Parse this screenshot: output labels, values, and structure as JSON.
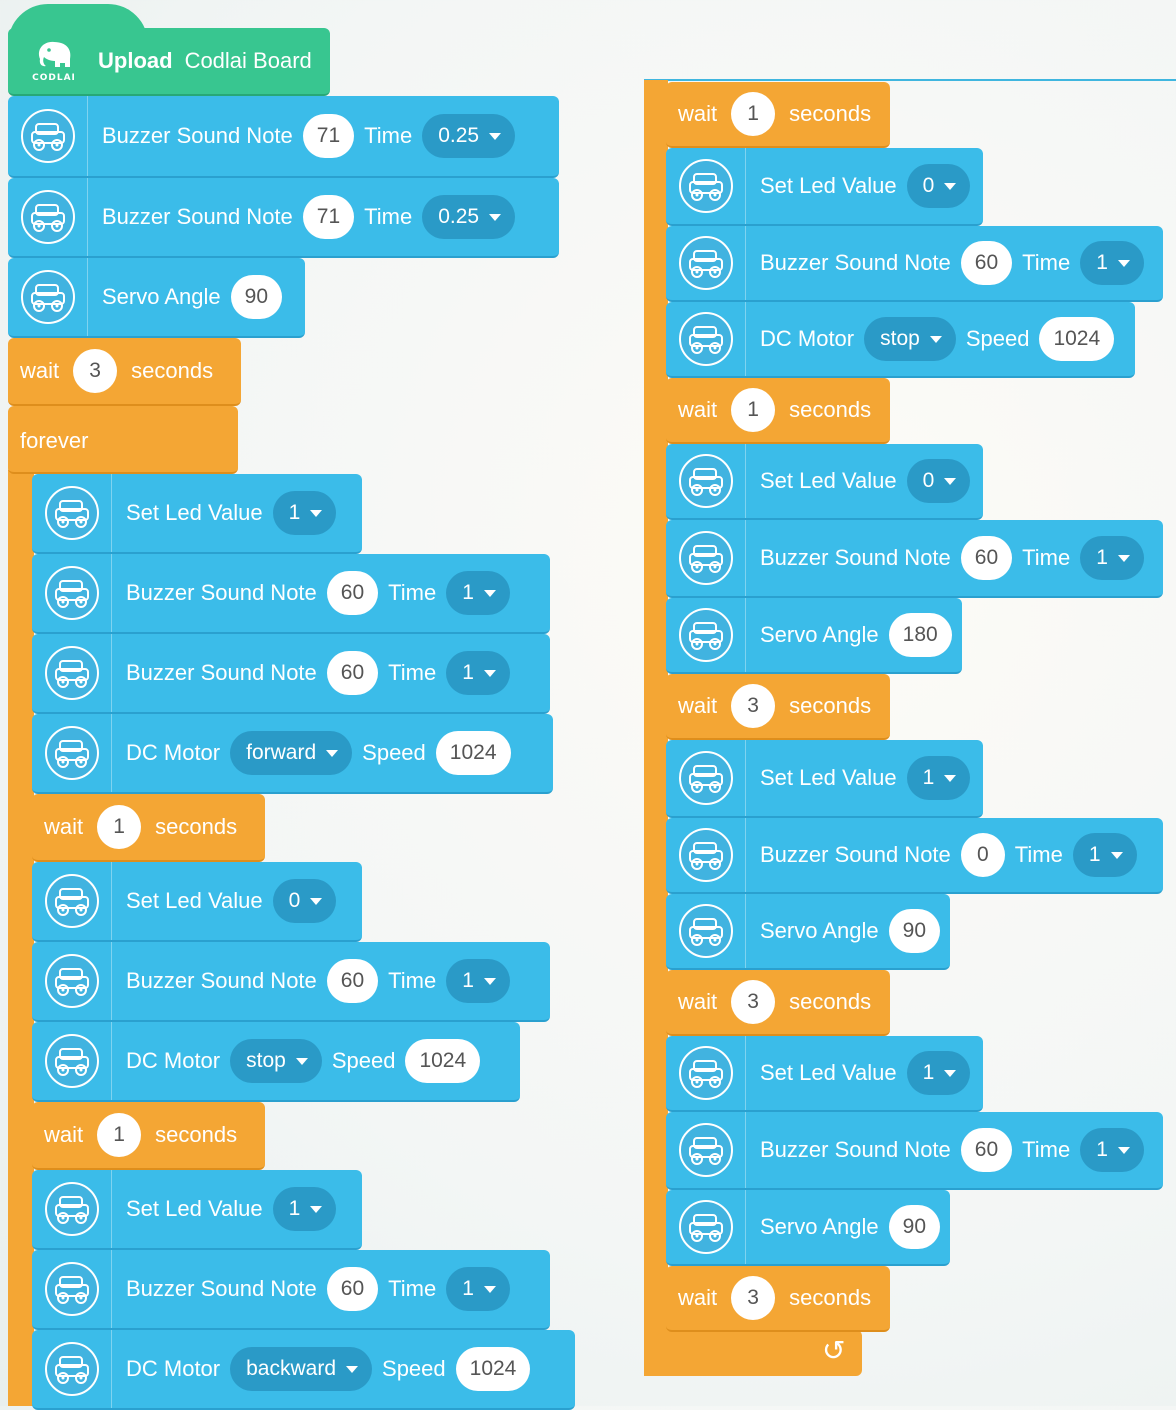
{
  "header": {
    "logo_text": "CODLAI",
    "upload_label": "Upload",
    "board_label": "Codlai Board"
  },
  "left_column": [
    {
      "kind": "device",
      "label": "Buzzer Sound Note",
      "value": "71",
      "label2": "Time",
      "dropdown": "0.25"
    },
    {
      "kind": "device",
      "label": "Buzzer Sound Note",
      "value": "71",
      "label2": "Time",
      "dropdown": "0.25"
    },
    {
      "kind": "device",
      "label": "Servo Angle",
      "value": "90"
    },
    {
      "kind": "wait",
      "label": "wait",
      "value": "3",
      "suffix": "seconds"
    },
    {
      "kind": "forever",
      "label": "forever"
    },
    {
      "kind": "device",
      "label": "Set Led Value",
      "dropdown": "1"
    },
    {
      "kind": "device",
      "label": "Buzzer Sound Note",
      "value": "60",
      "label2": "Time",
      "dropdown": "1"
    },
    {
      "kind": "device",
      "label": "Buzzer Sound Note",
      "value": "60",
      "label2": "Time",
      "dropdown": "1"
    },
    {
      "kind": "device",
      "label": "DC Motor",
      "dropdown": "forward",
      "label2": "Speed",
      "value2": "1024"
    },
    {
      "kind": "wait",
      "label": "wait",
      "value": "1",
      "suffix": "seconds"
    },
    {
      "kind": "device",
      "label": "Set Led Value",
      "dropdown": "0"
    },
    {
      "kind": "device",
      "label": "Buzzer Sound Note",
      "value": "60",
      "label2": "Time",
      "dropdown": "1"
    },
    {
      "kind": "device",
      "label": "DC Motor",
      "dropdown": "stop",
      "label2": "Speed",
      "value2": "1024"
    },
    {
      "kind": "wait",
      "label": "wait",
      "value": "1",
      "suffix": "seconds"
    },
    {
      "kind": "device",
      "label": "Set Led Value",
      "dropdown": "1"
    },
    {
      "kind": "device",
      "label": "Buzzer Sound Note",
      "value": "60",
      "label2": "Time",
      "dropdown": "1"
    },
    {
      "kind": "device",
      "label": "DC Motor",
      "dropdown": "backward",
      "label2": "Speed",
      "value2": "1024"
    }
  ],
  "right_column": [
    {
      "kind": "wait",
      "label": "wait",
      "value": "1",
      "suffix": "seconds"
    },
    {
      "kind": "device",
      "label": "Set Led Value",
      "dropdown": "0"
    },
    {
      "kind": "device",
      "label": "Buzzer Sound Note",
      "value": "60",
      "label2": "Time",
      "dropdown": "1"
    },
    {
      "kind": "device",
      "label": "DC Motor",
      "dropdown": "stop",
      "label2": "Speed",
      "value2": "1024"
    },
    {
      "kind": "wait",
      "label": "wait",
      "value": "1",
      "suffix": "seconds"
    },
    {
      "kind": "device",
      "label": "Set Led Value",
      "dropdown": "0"
    },
    {
      "kind": "device",
      "label": "Buzzer Sound Note",
      "value": "60",
      "label2": "Time",
      "dropdown": "1"
    },
    {
      "kind": "device",
      "label": "Servo Angle",
      "value": "180"
    },
    {
      "kind": "wait",
      "label": "wait",
      "value": "3",
      "suffix": "seconds"
    },
    {
      "kind": "device",
      "label": "Set Led Value",
      "dropdown": "1"
    },
    {
      "kind": "device",
      "label": "Buzzer Sound Note",
      "value": "0",
      "label2": "Time",
      "dropdown": "1"
    },
    {
      "kind": "device",
      "label": "Servo Angle",
      "value": "90"
    },
    {
      "kind": "wait",
      "label": "wait",
      "value": "3",
      "suffix": "seconds"
    },
    {
      "kind": "device",
      "label": "Set Led Value",
      "dropdown": "1"
    },
    {
      "kind": "device",
      "label": "Buzzer Sound Note",
      "value": "60",
      "label2": "Time",
      "dropdown": "1"
    },
    {
      "kind": "device",
      "label": "Servo Angle",
      "value": "90"
    },
    {
      "kind": "wait",
      "label": "wait",
      "value": "3",
      "suffix": "seconds"
    }
  ],
  "loop_end_icon": "loop-arrow-icon",
  "device_icon": "robot-car-icon",
  "colors": {
    "motion_blue": "#3bbce9",
    "control_orange": "#f4a634",
    "event_green": "#38c690",
    "dropdown_blue": "#2a9ac7"
  }
}
